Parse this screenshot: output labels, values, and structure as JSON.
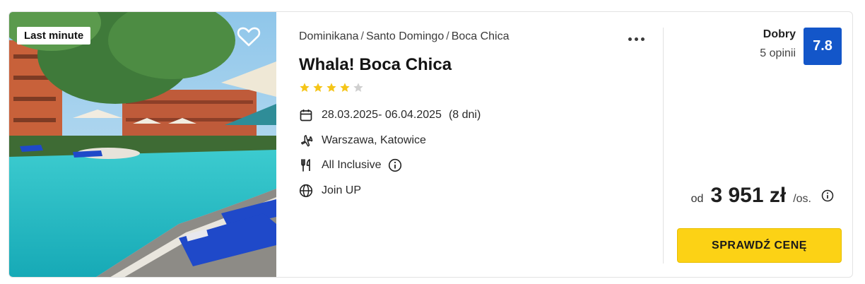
{
  "offer": {
    "badge": "Last minute",
    "breadcrumb": [
      "Dominikana",
      "Santo Domingo",
      "Boca Chica"
    ],
    "breadcrumb_separator": "/",
    "hotel_name": "Whala! Boca Chica",
    "stars": {
      "filled": 4,
      "total": 5
    },
    "dates": "28.03.2025- 06.04.2025",
    "duration": "(8 dni)",
    "departure": "Warszawa, Katowice",
    "board": "All Inclusive",
    "operator": "Join UP"
  },
  "rating": {
    "label": "Dobry",
    "reviews": "5 opinii",
    "score": "7.8"
  },
  "price": {
    "prefix": "od",
    "amount": "3 951 zł",
    "per": "/os."
  },
  "cta": {
    "label": "SPRAWDŹ CENĘ"
  },
  "colors": {
    "accent_yellow": "#fcd215",
    "score_blue": "#1356c9",
    "star_yellow": "#f5c518",
    "star_empty": "#cfcfcf"
  },
  "icons": [
    "heart-icon",
    "more-icon",
    "star-icon",
    "calendar-icon",
    "plane-icon",
    "cutlery-icon",
    "info-icon",
    "globe-icon"
  ]
}
